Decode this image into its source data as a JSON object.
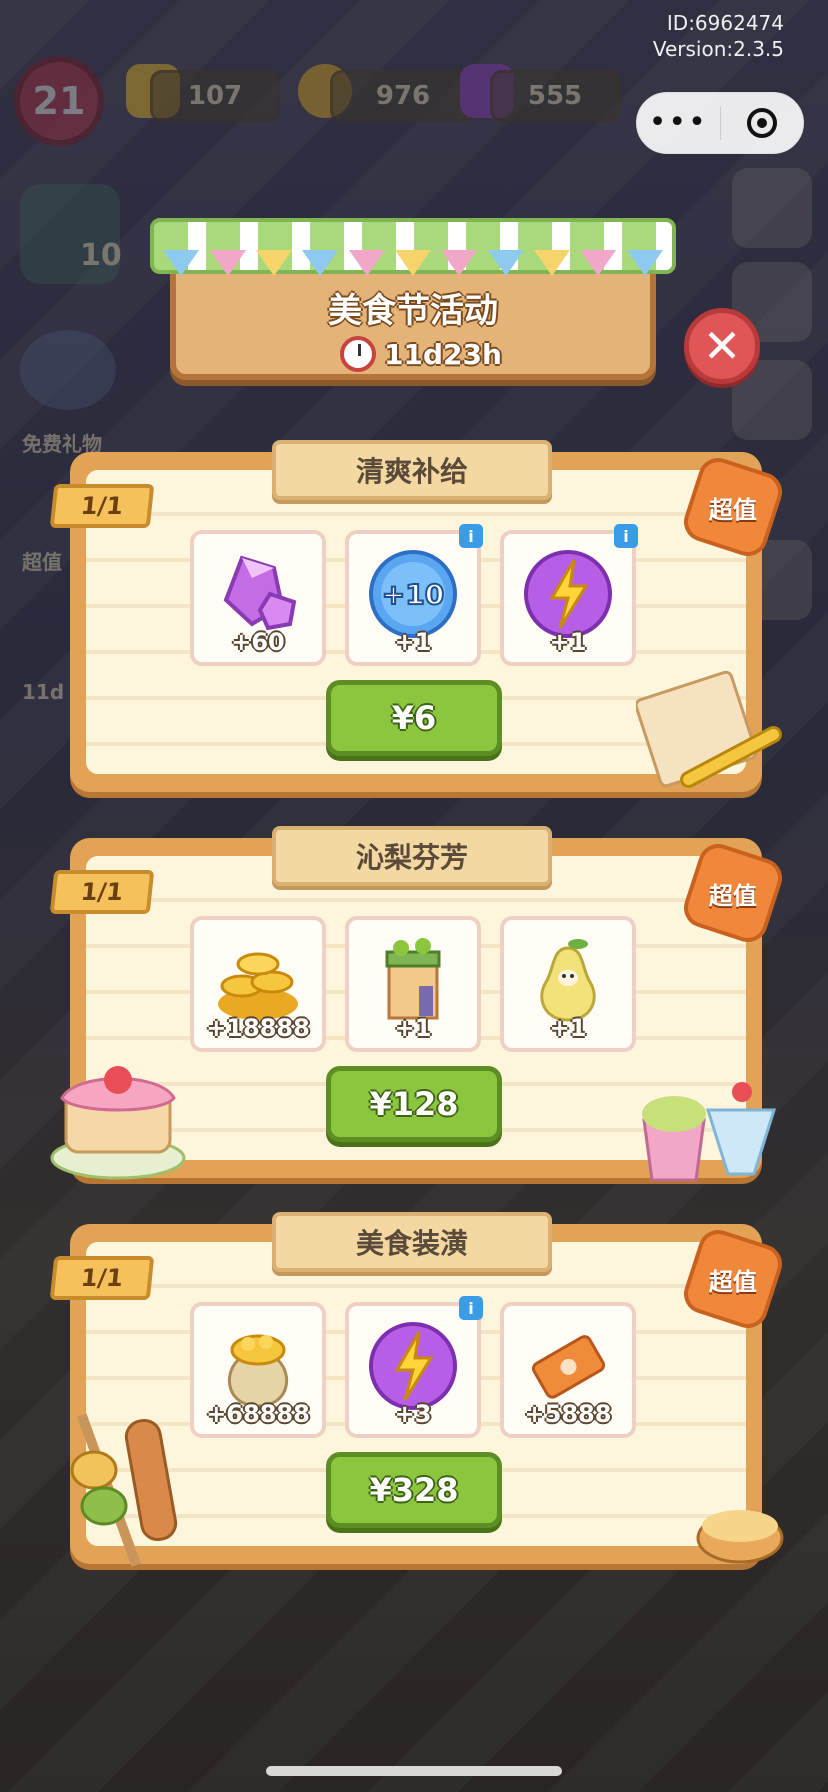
{
  "hud": {
    "id_text": "ID:6962474",
    "version_text": "Version:2.3.5",
    "level": "21",
    "energy": "107",
    "coins": "976",
    "gems": "555",
    "left_bubble_count": "10",
    "free_gift_label": "免费礼物",
    "side_label_2": "超值",
    "side_timer": "11d"
  },
  "event": {
    "title": "美食节活动",
    "time_left": "11d23h"
  },
  "packs": [
    {
      "name": "清爽补给",
      "count": "1/1",
      "badge": "超值",
      "price": "¥6",
      "items": [
        {
          "icon": "gem-icon",
          "qty": "+60",
          "info": false
        },
        {
          "icon": "plus-ten-bubble-icon",
          "qty": "+1",
          "info": true
        },
        {
          "icon": "energy-bubble-icon",
          "qty": "+1",
          "info": true
        }
      ]
    },
    {
      "name": "沁梨芬芳",
      "count": "1/1",
      "badge": "超值",
      "price": "¥128",
      "items": [
        {
          "icon": "coin-pile-icon",
          "qty": "+18888",
          "info": false
        },
        {
          "icon": "kiosk-icon",
          "qty": "+1",
          "info": false
        },
        {
          "icon": "pear-mascot-icon",
          "qty": "+1",
          "info": false
        }
      ]
    },
    {
      "name": "美食装潢",
      "count": "1/1",
      "badge": "超值",
      "price": "¥328",
      "items": [
        {
          "icon": "coin-sack-icon",
          "qty": "+68888",
          "info": false
        },
        {
          "icon": "energy-bubble-icon",
          "qty": "+3",
          "info": true
        },
        {
          "icon": "ticket-icon",
          "qty": "+5888",
          "info": false
        }
      ]
    }
  ],
  "info_label": "i",
  "capsule": {
    "more_label": "•••"
  },
  "colors": {
    "accent_green": "#8cc63f",
    "card_orange": "#e3a356",
    "badge_orange": "#f0873a",
    "close_red": "#e05656"
  }
}
